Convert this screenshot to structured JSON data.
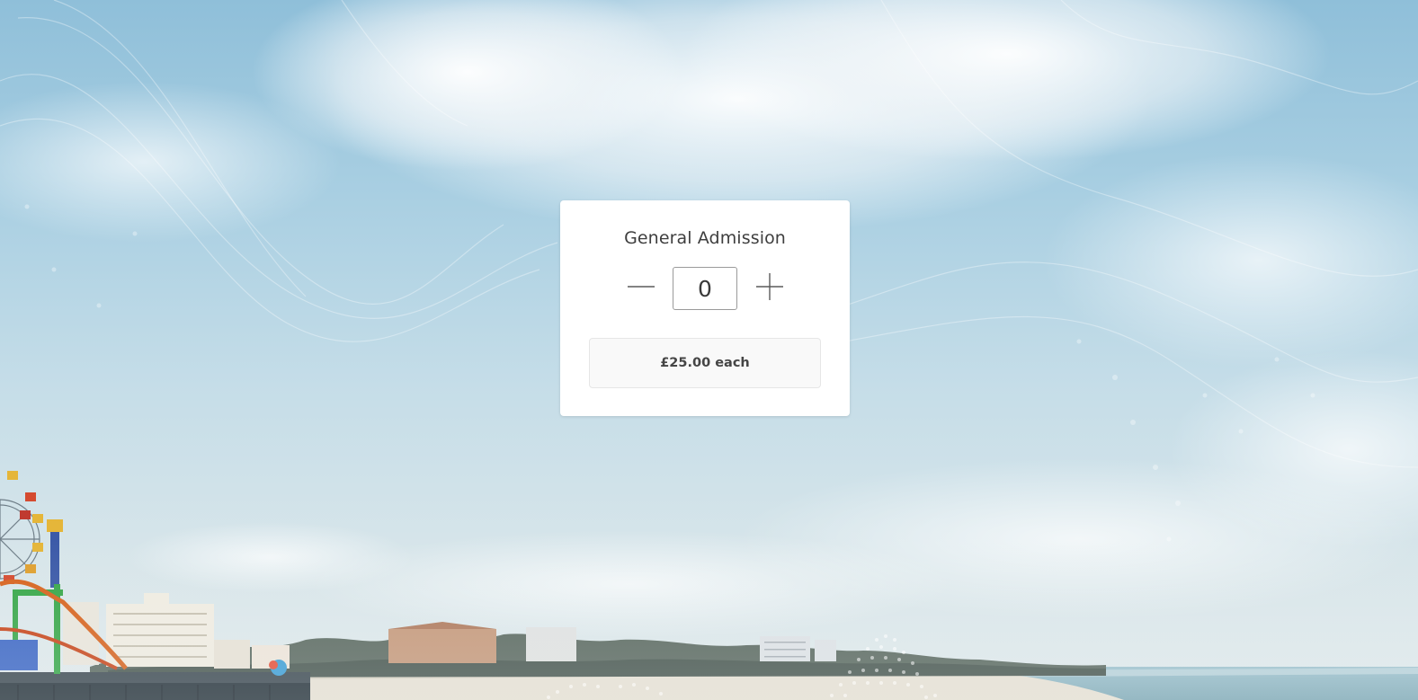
{
  "ticket": {
    "title": "General Admission",
    "quantity": "0",
    "price_label": "£25.00 each",
    "decrement_icon": "minus-icon",
    "increment_icon": "plus-icon"
  },
  "colors": {
    "card_background": "#ffffff",
    "price_box_background": "#f9f9f9",
    "text": "#3e3e3e"
  }
}
